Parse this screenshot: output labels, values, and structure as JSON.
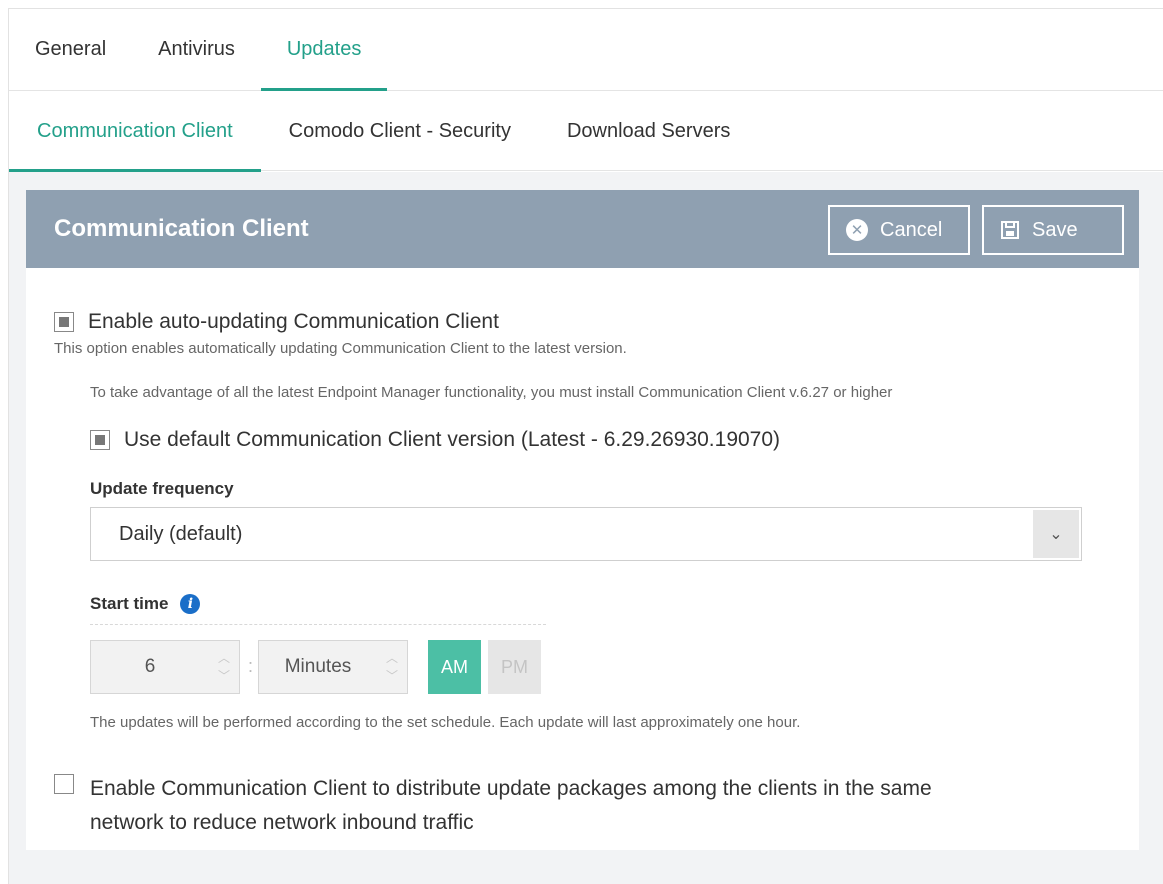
{
  "top_tabs": [
    {
      "label": "General"
    },
    {
      "label": "Antivirus"
    },
    {
      "label": "Updates"
    }
  ],
  "sub_tabs": [
    {
      "label": "Communication Client"
    },
    {
      "label": "Comodo Client - Security"
    },
    {
      "label": "Download Servers"
    }
  ],
  "panel": {
    "title": "Communication Client",
    "cancel_label": "Cancel",
    "save_label": "Save"
  },
  "auto_update": {
    "label": "Enable auto-updating Communication Client",
    "checked": true,
    "description": "This option enables automatically updating Communication Client to the latest version.",
    "note": "To take advantage of all the latest Endpoint Manager functionality, you must install Communication Client v.6.27 or higher"
  },
  "default_version": {
    "label": "Use default Communication Client version (Latest - 6.29.26930.19070)",
    "checked": true
  },
  "update_frequency": {
    "label": "Update frequency",
    "selected": "Daily (default)"
  },
  "start_time": {
    "label": "Start time",
    "hour": "6",
    "minutes_placeholder": "Minutes",
    "am_label": "AM",
    "pm_label": "PM",
    "selected_period": "AM",
    "note": "The updates will be performed according to the set schedule. Each update will last approximately one hour."
  },
  "distribute": {
    "label_line1": "Enable Communication Client to distribute update packages among the clients in the same",
    "label_line2": "network to reduce network inbound traffic",
    "checked": false
  },
  "colors": {
    "accent": "#23a08a",
    "header_bg": "#8fa0b1",
    "am_bg": "#4cbfa5",
    "info": "#1a6ec8"
  }
}
